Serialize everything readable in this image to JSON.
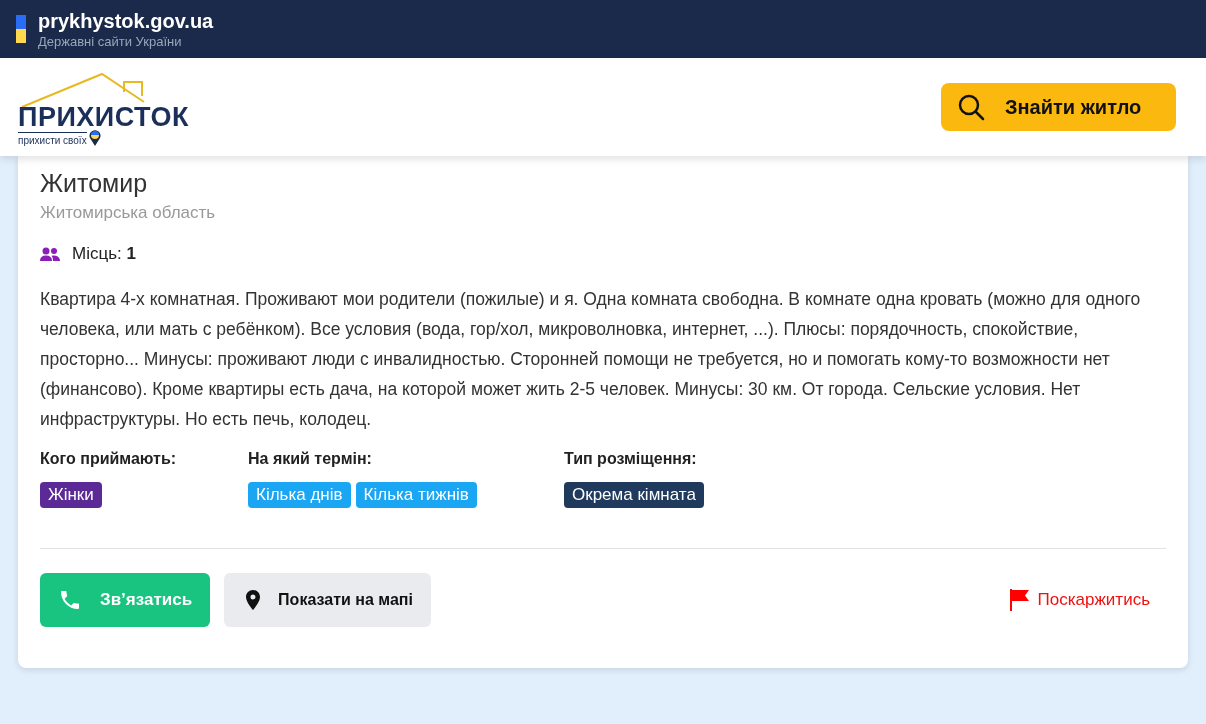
{
  "gov_bar": {
    "domain": "prykhystok.gov.ua",
    "subtitle": "Державні сайти України"
  },
  "header": {
    "logo": {
      "title": "ПРИХИСТОК",
      "tagline": "прихисти своїх"
    },
    "search_button": "Знайти житло"
  },
  "listing": {
    "city": "Житомир",
    "region": "Житомирська область",
    "places": {
      "label": "Місць:",
      "value": "1"
    },
    "description": "Квартира 4-х комнатная. Проживают мои родители (пожилые) и я. Одна комната свободна. В комнате одна кровать (можно для одного человека, или мать с ребёнком). Все условия (вода, гор/хол, микроволновка, интернет, ...). Плюсы: порядочность, спокойствие, просторно... Минусы: проживают люди с инвалидностью. Сторонней помощи не требуется, но и помогать кому-то возможности нет (финансово). Кроме квартиры есть дача, на которой может жить 2-5 человек. Минусы: 30 км. От города. Сельские условия. Нет инфраструктуры. Но есть печь, колодец.",
    "attributes": [
      {
        "label": "Кого приймають:",
        "tags": [
          {
            "text": "Жінки",
            "color": "#5b2a96"
          }
        ]
      },
      {
        "label": "На який термін:",
        "tags": [
          {
            "text": "Кілька днів",
            "color": "#1aa6f2"
          },
          {
            "text": "Кілька тижнів",
            "color": "#1aa6f2"
          }
        ]
      },
      {
        "label": "Тип розміщення:",
        "tags": [
          {
            "text": "Окрема кімната",
            "color": "#1f3a5c"
          }
        ]
      }
    ],
    "actions": {
      "contact": "Зв’язатись",
      "map": "Показати на мапі",
      "report": "Поскаржитись"
    }
  }
}
